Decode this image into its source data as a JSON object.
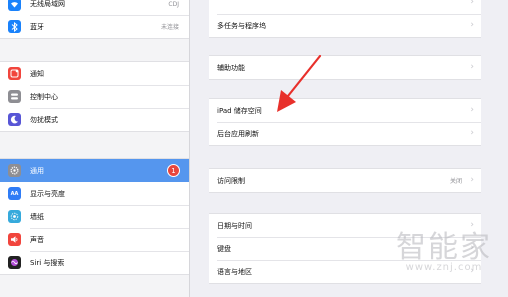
{
  "sidebar": {
    "wifi": {
      "label": "无线局域网",
      "value": "CDJ",
      "icon": "wifi-icon",
      "color": "#1a82fb"
    },
    "bluetooth": {
      "label": "蓝牙",
      "value": "未连接",
      "icon": "bluetooth-icon",
      "color": "#1a82fb"
    },
    "notifications": {
      "label": "通知",
      "icon": "notifications-icon",
      "color": "#f1453d"
    },
    "control_center": {
      "label": "控制中心",
      "icon": "control-center-icon",
      "color": "#8e8e93"
    },
    "do_not_disturb": {
      "label": "勿扰模式",
      "icon": "moon-icon",
      "color": "#5856d6"
    },
    "general": {
      "label": "通用",
      "badge": "1",
      "icon": "gear-icon",
      "color": "#8e8e93"
    },
    "display": {
      "label": "显示与亮度",
      "icon": "display-icon",
      "color": "#2f7cf6"
    },
    "wallpaper": {
      "label": "墙纸",
      "icon": "wallpaper-icon",
      "color": "#36aadc"
    },
    "sounds": {
      "label": "声音",
      "icon": "sound-icon",
      "color": "#f1453d"
    },
    "siri": {
      "label": "Siri 与搜索",
      "icon": "siri-icon",
      "color": "#222222"
    },
    "active_color": "#5596ee"
  },
  "detail": {
    "group1": {
      "item0": "",
      "multitasking": "多任务与程序坞"
    },
    "group2": {
      "accessibility": "辅助功能"
    },
    "group3": {
      "storage": "iPad 储存空间",
      "background_refresh": "后台应用刷新"
    },
    "group4": {
      "restrictions": "访问限制",
      "restrictions_value": "关闭"
    },
    "group5": {
      "date_time": "日期与时间",
      "keyboard": "键盘",
      "language_region": "语言与地区"
    }
  },
  "watermark": {
    "text": "智能家",
    "url": "www.znj.com"
  },
  "annotation": {
    "arrow_color": "#e8302b"
  }
}
